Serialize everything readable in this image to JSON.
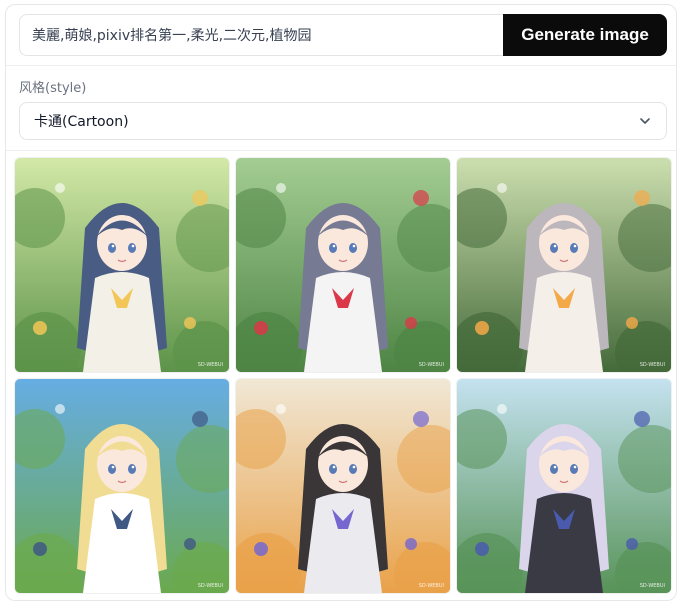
{
  "prompt": {
    "value": "美麗,萌娘,pixiv排名第一,柔光,二次元,植物园"
  },
  "generate_button": {
    "label": "Generate image"
  },
  "style": {
    "label": "风格(style)",
    "selected": "卡通(Cartoon)"
  },
  "gallery": {
    "watermark": "SD-WEBUI",
    "images": [
      {
        "name": "garden-girl-straw-hat",
        "sky": "#cfe7a0",
        "ground": "#4f8a3a",
        "hair": "#3a4f7a",
        "dress": "#f2efe6",
        "accent": "#f2c24a"
      },
      {
        "name": "garden-girl-red-bow",
        "sky": "#9cc98a",
        "ground": "#3f7a35",
        "hair": "#6b6f8a",
        "dress": "#f4f4f4",
        "accent": "#d8283a"
      },
      {
        "name": "sunflower-girl",
        "sky": "#c8dca8",
        "ground": "#355e2a",
        "hair": "#b7b0b8",
        "dress": "#f3eee8",
        "accent": "#f4a23a"
      },
      {
        "name": "blonde-girl-sky",
        "sky": "#5aa6e2",
        "ground": "#5fa23f",
        "hair": "#f0d98a",
        "dress": "#ffffff",
        "accent": "#2f4a7a"
      },
      {
        "name": "dark-hair-flower-field",
        "sky": "#efe6d2",
        "ground": "#e89a3a",
        "hair": "#2a2528",
        "dress": "#e9e9ee",
        "accent": "#6a5acd"
      },
      {
        "name": "lavender-hair-waving",
        "sky": "#bfe0ef",
        "ground": "#4a8a4a",
        "hair": "#d8d2ea",
        "dress": "#2a2a36",
        "accent": "#3b4ea8"
      }
    ]
  }
}
